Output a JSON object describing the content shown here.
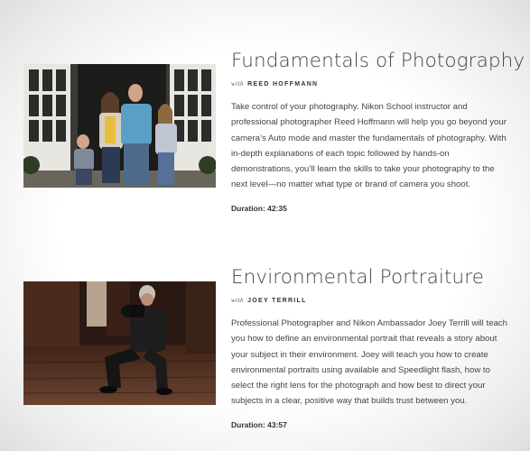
{
  "courses": [
    {
      "title": "Fundamentals of Photography",
      "with_label": "with",
      "instructor": "REED HOFFMANN",
      "description": "Take control of your photography. Nikon School instructor and professional photographer Reed Hoffmann will help you go beyond your camera’s Auto mode and master the fundamentals of photography. With in-depth explanations of each topic followed by hands-on demonstrations, you’ll learn the skills to take your photography to the next level—no matter what type or brand of camera you shoot.",
      "duration": "Duration: 42:35"
    },
    {
      "title": "Environmental Portraiture",
      "with_label": "with",
      "instructor": "JOEY TERRILL",
      "description": "Professional Photographer and Nikon Ambassador Joey Terrill will teach you how to define an environmental portrait that reveals a story about your subject in their environment. Joey will teach you how to create environmental portraits using available and Speedlight flash, how to select the right lens for the photograph and how best to direct your subjects in a clear, positive way that builds trust between you.",
      "duration": "Duration: 43:57"
    }
  ]
}
